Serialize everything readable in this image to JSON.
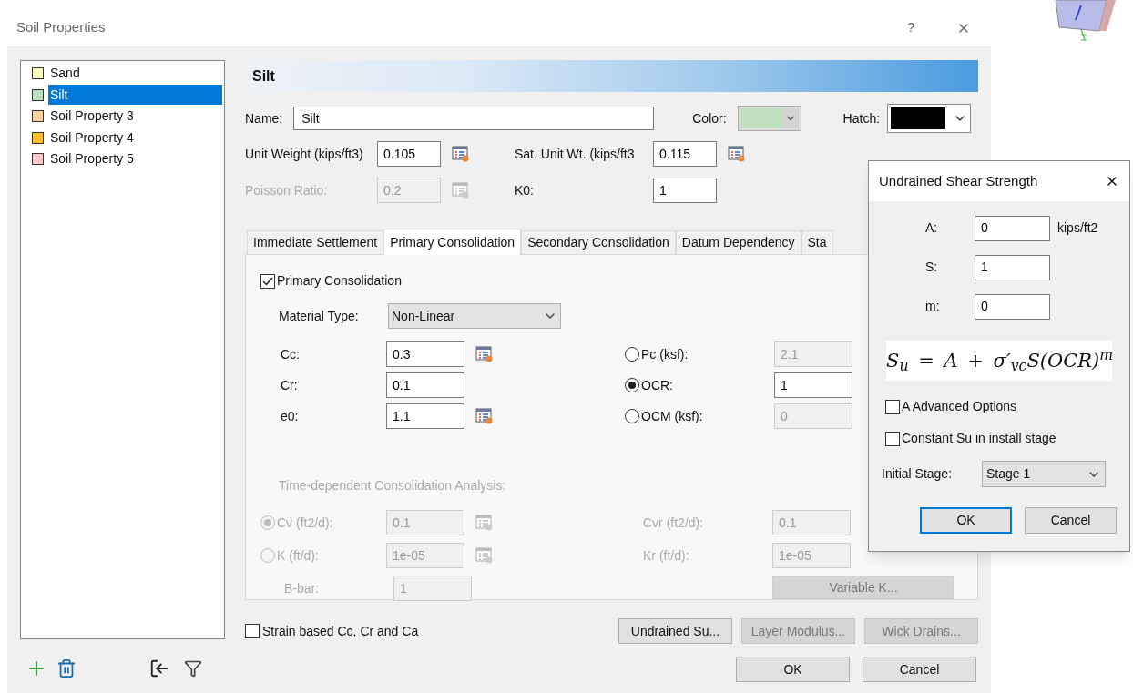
{
  "window": {
    "title": "Soil Properties",
    "help": "?"
  },
  "soil_list": [
    {
      "name": "Sand",
      "color": "#ffffc0",
      "selected": false
    },
    {
      "name": "Silt",
      "color": "#bfe0bf",
      "selected": true
    },
    {
      "name": "Soil Property 3",
      "color": "#ffd0a0",
      "selected": false
    },
    {
      "name": "Soil Property 4",
      "color": "#ffc030",
      "selected": false
    },
    {
      "name": "Soil Property 5",
      "color": "#ffc8c8",
      "selected": false
    }
  ],
  "header": "Silt",
  "name_field": {
    "label": "Name:",
    "value": "Silt"
  },
  "color_field": {
    "label": "Color:",
    "color": "#bfe0bf"
  },
  "hatch_field": {
    "label": "Hatch:",
    "color": "#000000"
  },
  "props": [
    {
      "label": "Unit Weight (kips/ft3)",
      "value": "0.105",
      "disabled": false,
      "calc": true
    },
    {
      "label": "Sat. Unit Wt. (kips/ft3",
      "value": "0.115",
      "disabled": false,
      "calc": true
    },
    {
      "label": "Poisson Ratio:",
      "value": "0.2",
      "disabled": true,
      "calc": true
    },
    {
      "label": "K0:",
      "value": "1",
      "disabled": false,
      "calc": false
    }
  ],
  "tabs": [
    {
      "label": "Immediate Settlement",
      "selected": false
    },
    {
      "label": "Primary Consolidation",
      "selected": true
    },
    {
      "label": "Secondary Consolidation",
      "selected": false
    },
    {
      "label": "Datum Dependency",
      "selected": false
    },
    {
      "label": "Sta",
      "selected": false
    }
  ],
  "primary": {
    "label": "Primary Consolidation",
    "checked": true,
    "material_type": {
      "label": "Material Type:",
      "value": "Non-Linear"
    },
    "left_fields": [
      {
        "label": "Cc:",
        "value": "0.3",
        "calc": true
      },
      {
        "label": "Cr:",
        "value": "0.1",
        "calc": false
      },
      {
        "label": "e0:",
        "value": "1.1",
        "calc": true
      }
    ],
    "right_fields": [
      {
        "label": "Pc (ksf):",
        "value": "2.1",
        "selected": false,
        "disabled": true
      },
      {
        "label": "OCR:",
        "value": "1",
        "selected": true,
        "disabled": false
      },
      {
        "label": "OCM (ksf):",
        "value": "0",
        "selected": false,
        "disabled": true
      }
    ],
    "time_heading": "Time-dependent Consolidation Analysis:",
    "time_left": [
      {
        "kind": "radio",
        "label": "Cv (ft2/d):",
        "value": "0.1",
        "selected": true
      },
      {
        "kind": "radio",
        "label": "K (ft/d):",
        "value": "1e-05",
        "selected": false
      },
      {
        "kind": "plain",
        "label": "B-bar:",
        "value": "1"
      }
    ],
    "time_right": [
      {
        "label": "Cvr (ft2/d):",
        "value": "0.1"
      },
      {
        "label": "Kr (ft/d):",
        "value": "1e-05"
      }
    ],
    "variable_button": "Variable K..."
  },
  "strain_checkbox": {
    "label": "Strain based Cc, Cr and Ca",
    "checked": false
  },
  "action_buttons": [
    {
      "label": "Undrained Su...",
      "disabled": false
    },
    {
      "label": "Layer Modulus...",
      "disabled": true
    },
    {
      "label": "Wick Drains...",
      "disabled": true
    }
  ],
  "ok": "OK",
  "cancel": "Cancel",
  "popup": {
    "title": "Undrained Shear Strength",
    "fields": [
      {
        "label": "A:",
        "value": "0",
        "unit": "kips/ft2"
      },
      {
        "label": "S:",
        "value": "1"
      },
      {
        "label": "m:",
        "value": "0"
      }
    ],
    "formula": "S$_{u}$ = A + σ′$_{vc}$S(OCR)$^{m}$",
    "checkboxes": [
      {
        "label": "A Advanced Options",
        "checked": false
      },
      {
        "label": "Constant Su in install stage",
        "checked": false
      }
    ],
    "stage": {
      "label": "Initial Stage:",
      "value": "Stage 1"
    },
    "ok": "OK",
    "cancel": "Cancel"
  }
}
